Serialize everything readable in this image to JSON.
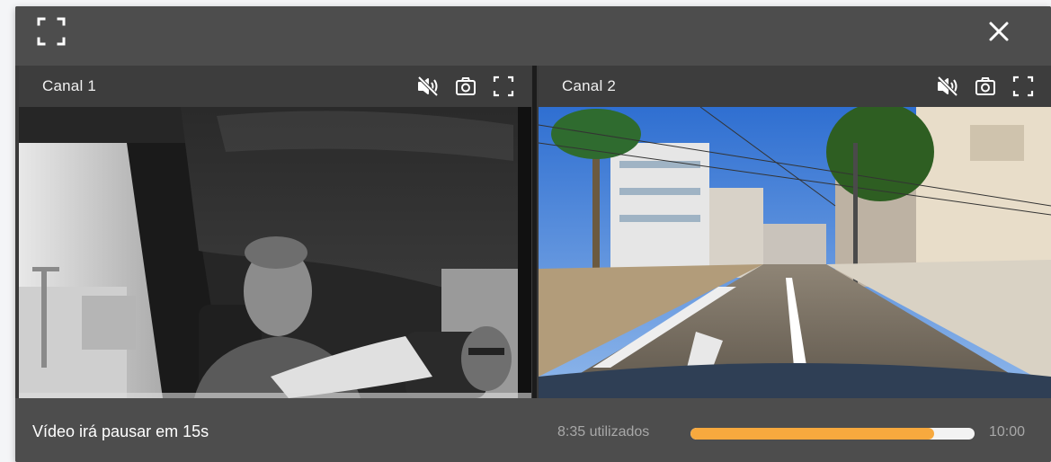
{
  "player": {
    "channels": [
      {
        "title": "Canal 1"
      },
      {
        "title": "Canal 2"
      }
    ],
    "icons": {
      "top_left": "fullscreen-icon",
      "top_right": "close-icon",
      "channel_controls": [
        "mute-icon",
        "camera-icon",
        "fullscreen-icon"
      ]
    }
  },
  "footer": {
    "pause_message": "Vídeo irá pausar em 15s",
    "used": "8:35 utilizados",
    "total": "10:00",
    "progress_fraction": 0.858
  },
  "colors": {
    "window_bg": "#4d4d4d",
    "channel_header_bg": "#3d3d3d",
    "progress_fill": "#f7a93e",
    "progress_track": "#f3f3f3"
  }
}
